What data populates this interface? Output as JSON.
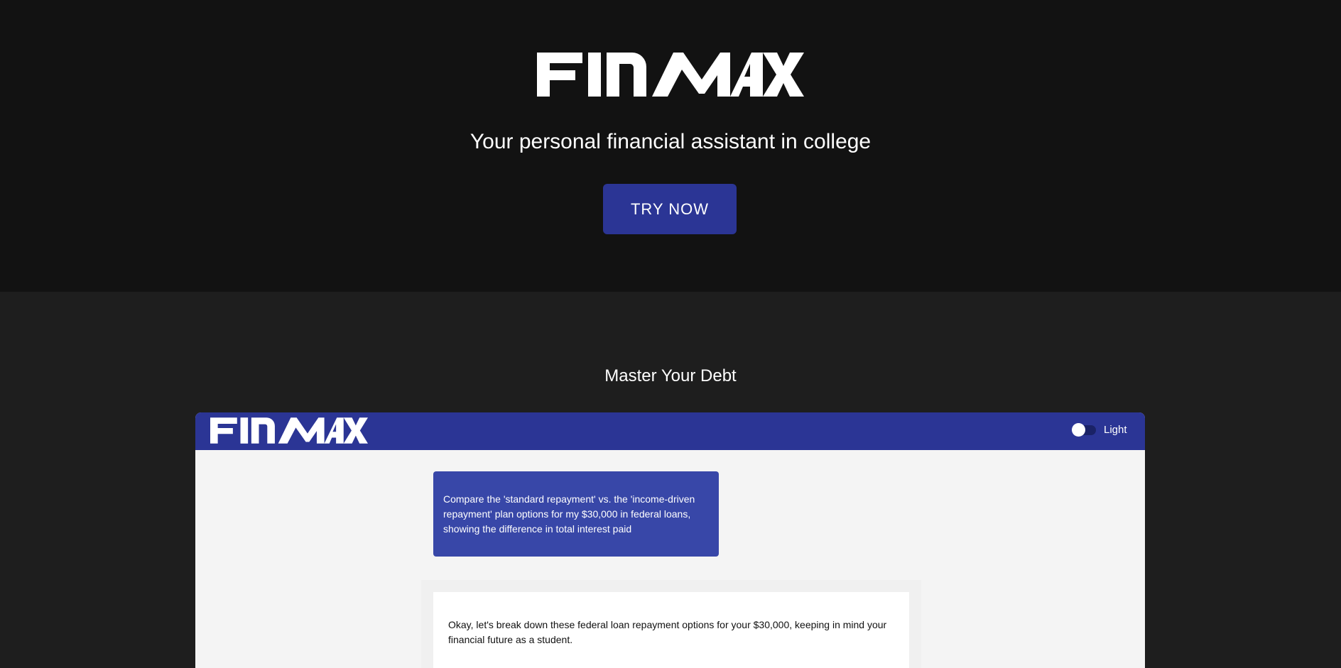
{
  "hero": {
    "logo_text": "FINMAX",
    "tagline": "Your personal financial assistant in college",
    "cta_label": "TRY NOW"
  },
  "section": {
    "title": "Master Your Debt"
  },
  "demo": {
    "logo_text": "FINMAX",
    "theme_label": "Light",
    "theme_dark_mode_on": false,
    "user_message": "Compare the 'standard repayment' vs. the 'income-driven repayment' plan options for my $30,000 in federal loans, showing the difference in total interest paid",
    "assistant_reply": "Okay, let's break down these federal loan repayment options for your $30,000, keeping in mind your financial future as a student."
  },
  "colors": {
    "hero_bg": "#121212",
    "section_bg": "#1e1e1e",
    "accent": "#2b3595",
    "user_bubble": "#3847a8",
    "chat_bg": "#f4f4f4"
  }
}
